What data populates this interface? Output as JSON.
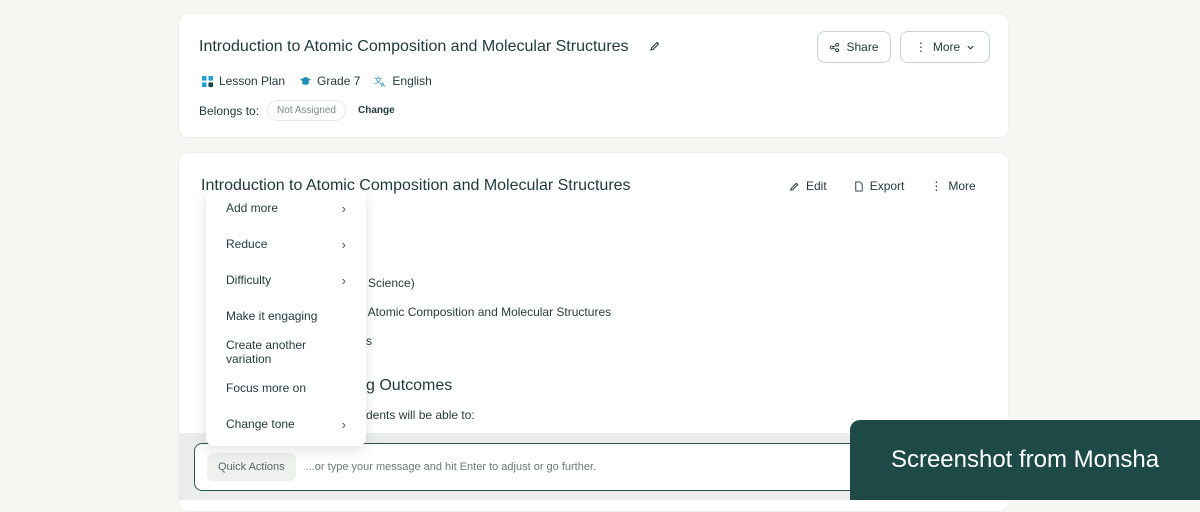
{
  "header": {
    "title": "Introduction to Atomic Composition and Molecular Structures",
    "share_label": "Share",
    "more_label": "More",
    "tags": {
      "type": "Lesson Plan",
      "grade": "Grade 7",
      "language": "English"
    },
    "belongs_label": "Belongs to:",
    "assignment": "Not Assigned",
    "change_label": "Change"
  },
  "content": {
    "title": "Introduction to Atomic Composition and Molecular Structures",
    "toolbar": {
      "edit": "Edit",
      "export": "Export",
      "more": "More"
    },
    "lines": [
      "Science)",
      "to Atomic Composition and Molecular Structures",
      "s"
    ],
    "section_heading": "g Outcomes",
    "section_text": "dents will be able to:"
  },
  "menu": {
    "items": [
      {
        "label": "Add more",
        "has_submenu": true
      },
      {
        "label": "Reduce",
        "has_submenu": true
      },
      {
        "label": "Difficulty",
        "has_submenu": true
      },
      {
        "label": "Make it engaging",
        "has_submenu": false
      },
      {
        "label": "Create another variation",
        "has_submenu": false
      },
      {
        "label": "Focus more on",
        "has_submenu": false
      },
      {
        "label": "Change tone",
        "has_submenu": true
      }
    ]
  },
  "chat": {
    "quick_actions": "Quick Actions",
    "placeholder": "...or type your message and hit Enter to adjust or go further."
  },
  "banner": {
    "text": "Screenshot from Monsha"
  },
  "colors": {
    "accent": "#1d4a46",
    "brand_blue": "#2a9fd6",
    "text": "#1f3a3a"
  }
}
